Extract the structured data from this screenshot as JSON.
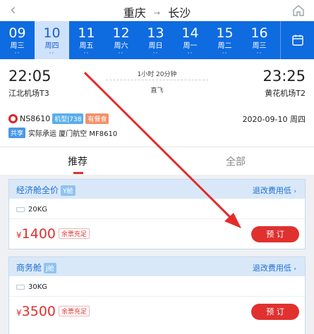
{
  "header": {
    "origin": "重庆",
    "destination": "长沙",
    "back_icon": "chevron-left-icon",
    "home_icon": "home-icon"
  },
  "dates": [
    {
      "day": "09",
      "weekday": "周三",
      "dots": "··",
      "selected": false
    },
    {
      "day": "10",
      "weekday": "周四",
      "dots": "··",
      "selected": true
    },
    {
      "day": "11",
      "weekday": "周五",
      "dots": "··",
      "selected": false
    },
    {
      "day": "12",
      "weekday": "周六",
      "dots": "··",
      "selected": false
    },
    {
      "day": "13",
      "weekday": "周日",
      "dots": "··",
      "selected": false
    },
    {
      "day": "14",
      "weekday": "周一",
      "dots": "··",
      "selected": false
    },
    {
      "day": "15",
      "weekday": "周二",
      "dots": "··",
      "selected": false
    },
    {
      "day": "16",
      "weekday": "周三",
      "dots": "··",
      "selected": false
    }
  ],
  "flight": {
    "dep_time": "22:05",
    "dep_airport": "江北机场T3",
    "arr_time": "23:25",
    "arr_airport": "黄花机场T2",
    "duration": "1小时 20分钟",
    "stops": "直飞",
    "number": "NS8610",
    "aircraft": "机型|738",
    "meal": "有餐食",
    "date": "2020-09-10 周四",
    "share_label": "共享",
    "share_text": "实际承运 厦门航空 MF8610"
  },
  "tabs": {
    "recommended": "推荐",
    "all": "全部"
  },
  "fares": [
    {
      "cabin": "经济舱全价",
      "class": "Y舱",
      "rules": "退改费用低",
      "baggage": "20KG",
      "currency": "¥",
      "price": "1400",
      "stock": "余票充足",
      "book": "预 订"
    },
    {
      "cabin": "商务舱",
      "class": "J舱",
      "rules": "退改费用低",
      "baggage": "30KG",
      "currency": "¥",
      "price": "3500",
      "stock": "余票充足",
      "book": "预 订"
    }
  ],
  "colors": {
    "primary": "#0f6be0",
    "accent_red": "#e0312f",
    "link_blue": "#1c6fd1"
  }
}
